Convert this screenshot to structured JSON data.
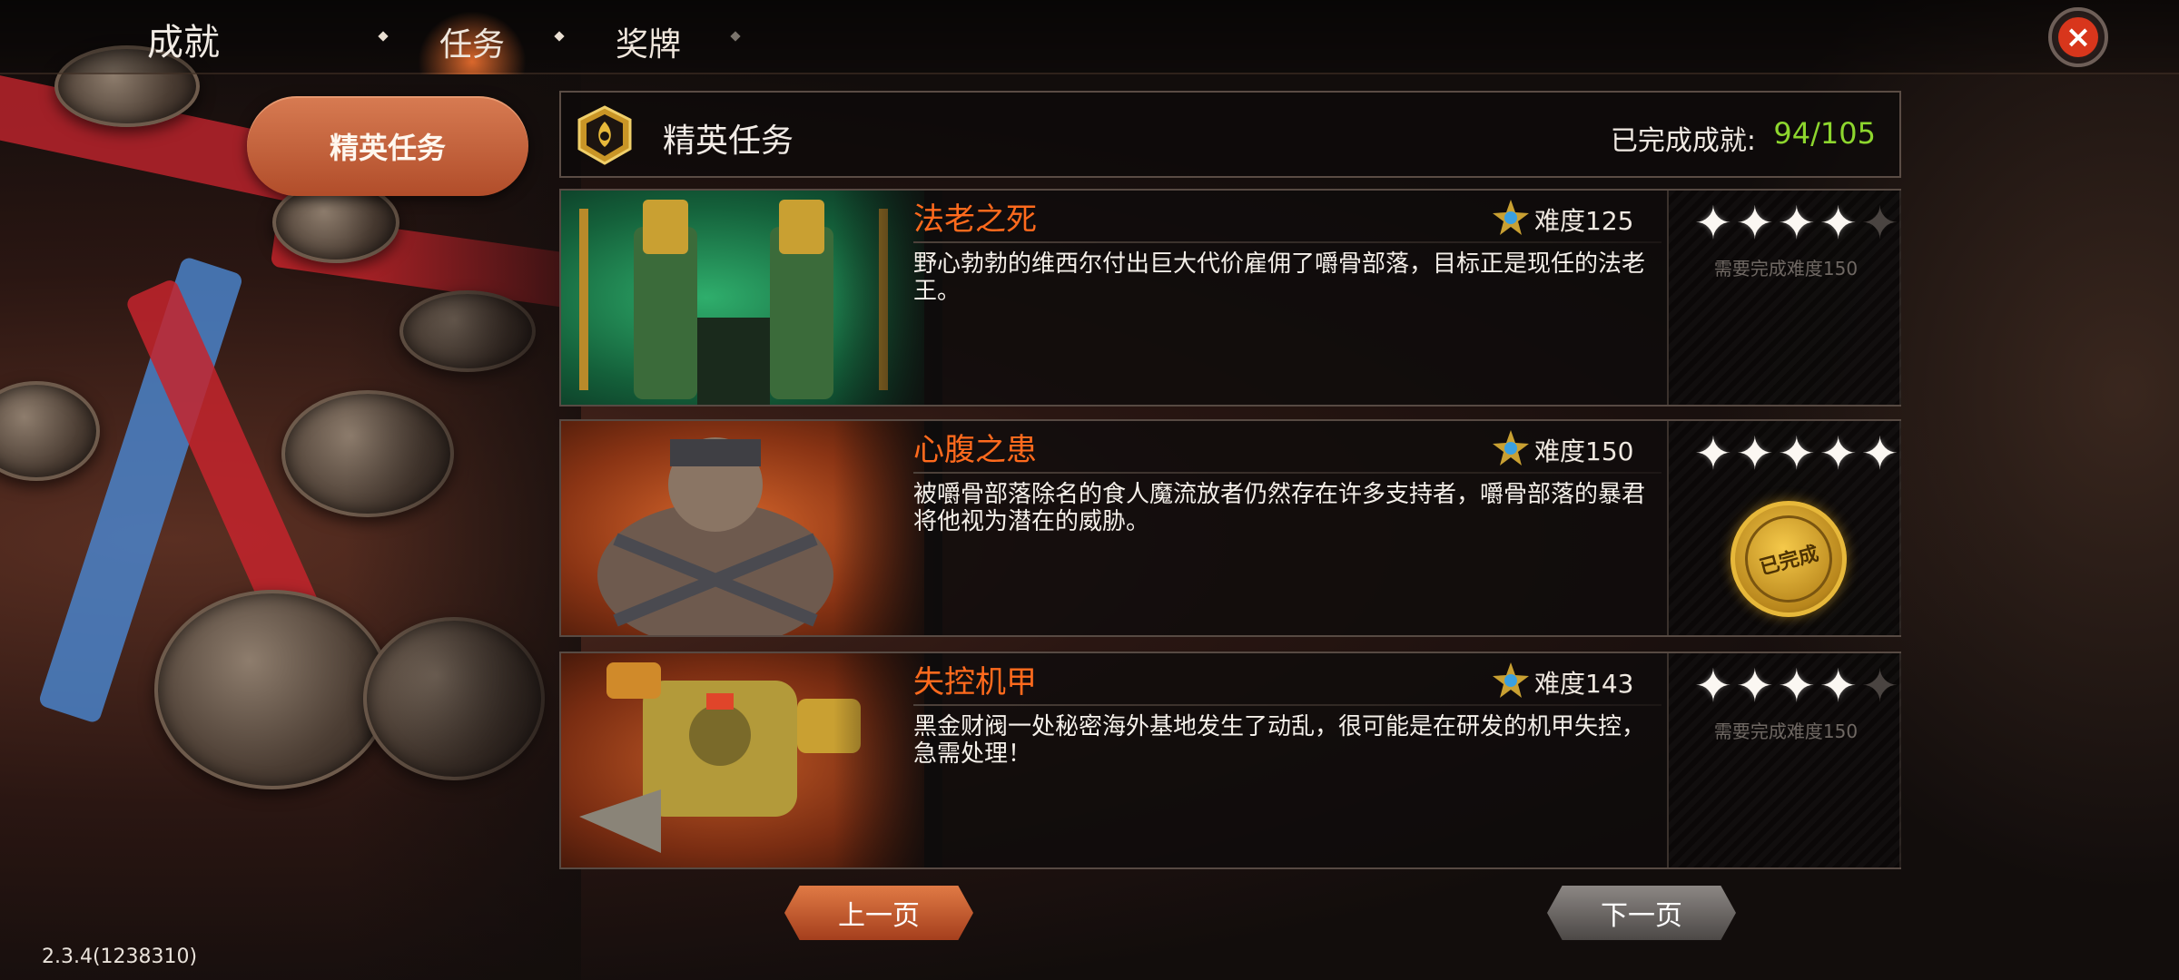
{
  "app": {
    "title": "成就",
    "tabs": [
      {
        "label": "任务",
        "active": true
      },
      {
        "label": "奖牌",
        "active": false
      }
    ],
    "close_icon": "close-icon"
  },
  "sidebar": {
    "items": [
      {
        "label": "精英任务",
        "active": true
      }
    ]
  },
  "header": {
    "title": "精英任务",
    "emblem_icon": "elite-emblem-icon",
    "completed_label": "已完成成就:",
    "completed_value": "94/105"
  },
  "missions": [
    {
      "name": "法老之死",
      "difficulty": "难度125",
      "description": "野心勃勃的维西尔付出巨大代价雇佣了嚼骨部落，目标正是现任的法老王。",
      "stars_earned": 4,
      "stars_total": 5,
      "status_text": "需要完成难度150",
      "art_theme": "#1f8a55"
    },
    {
      "name": "心腹之患",
      "difficulty": "难度150",
      "description": "被嚼骨部落除名的食人魔流放者仍然存在许多支持者，嚼骨部落的暴君将他视为潜在的威胁。",
      "stars_earned": 5,
      "stars_total": 5,
      "status_text": "已完成",
      "art_theme": "#b5491d"
    },
    {
      "name": "失控机甲",
      "difficulty": "难度143",
      "description": "黑金财阀一处秘密海外基地发生了动乱，很可能是在研发的机甲失控，急需处理！",
      "stars_earned": 4,
      "stars_total": 5,
      "status_text": "需要完成难度150",
      "art_theme": "#a8441c"
    }
  ],
  "pager": {
    "prev_label": "上一页",
    "next_label": "下一页"
  },
  "footer": {
    "version": "2.3.4(1238310)"
  },
  "colors": {
    "accent_orange": "#ff6a1d",
    "completed_green": "#8dd62e",
    "close_red": "#d8361c",
    "seal_gold": "#e7b83a"
  }
}
